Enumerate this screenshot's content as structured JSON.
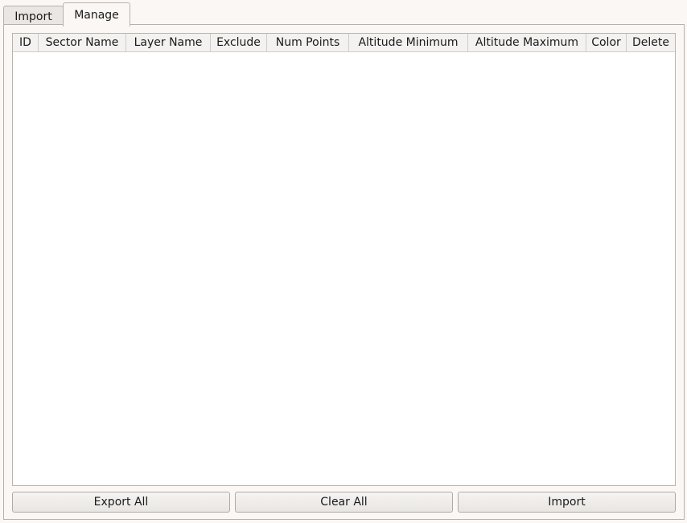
{
  "tabs": [
    {
      "label": "Import",
      "active": false
    },
    {
      "label": "Manage",
      "active": true
    }
  ],
  "table": {
    "columns": [
      "ID",
      "Sector Name",
      "Layer Name",
      "Exclude",
      "Num Points",
      "Altitude Minimum",
      "Altitude Maximum",
      "Color",
      "Delete"
    ],
    "rows": []
  },
  "buttons": {
    "export_all": "Export All",
    "clear_all": "Clear All",
    "import": "Import"
  }
}
